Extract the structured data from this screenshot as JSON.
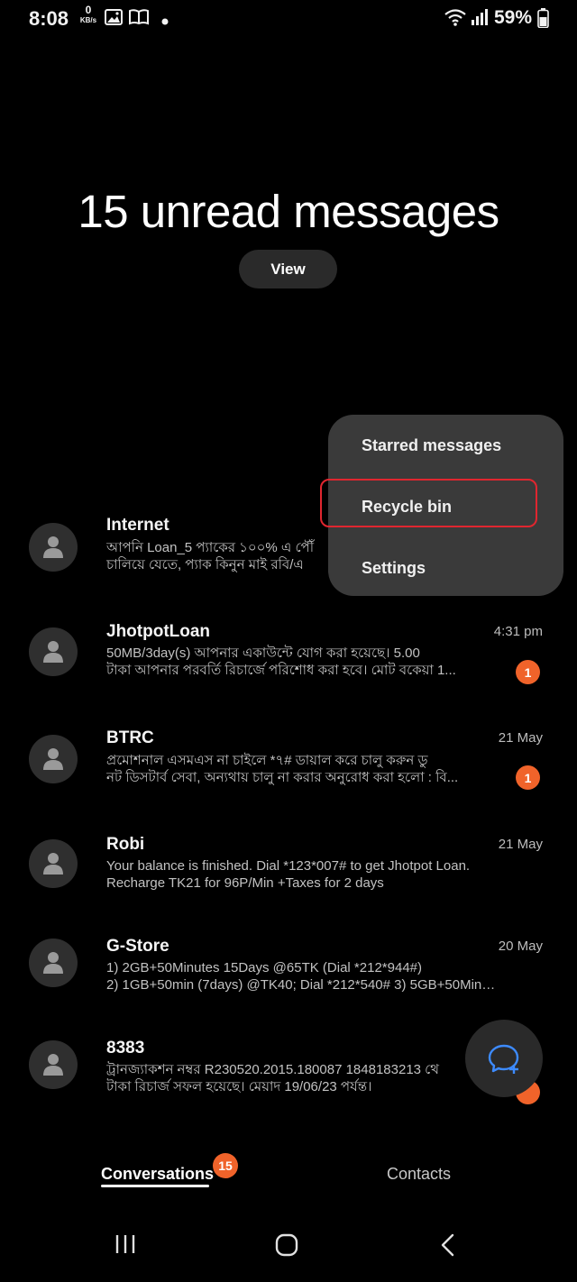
{
  "status_bar": {
    "time": "8:08",
    "net_speed_value": "0",
    "net_speed_unit": "KB/s",
    "battery": "59%"
  },
  "header": {
    "headline": "15 unread messages",
    "view_label": "View"
  },
  "menu": {
    "items": [
      {
        "label": "Starred messages"
      },
      {
        "label": "Recycle bin"
      },
      {
        "label": "Settings"
      }
    ]
  },
  "conversations": [
    {
      "name": "Internet",
      "time": "",
      "preview_line1": "আপনি Loan_5 প্যাকের ১০০% এ পৌঁ",
      "preview_line2": "চালিয়ে যেতে, প্যাক কিনুন মাই রবি/এ",
      "badge": ""
    },
    {
      "name": "JhotpotLoan",
      "time": "4:31 pm",
      "preview_line1": "50MB/3day(s) আপনার একাউন্টে যোগ করা হয়েছে। 5.00",
      "preview_line2": "টাকা আপনার পরবর্তি রিচার্জে পরিশোধ করা হবে। মোট বকেয়া 1...",
      "badge": "1"
    },
    {
      "name": "BTRC",
      "time": "21 May",
      "preview_line1": "প্রমোশনাল এসমএস না চাইলে *৭# ডায়াল করে চালু করুন ডু",
      "preview_line2": "নট ডিসটার্ব সেবা, অন্যথায় চালু না করার অনুরোধ করা হলো : বি...",
      "badge": "1"
    },
    {
      "name": "Robi",
      "time": "21 May",
      "preview_line1": "Your balance is finished. Dial *123*007# to get Jhotpot Loan.",
      "preview_line2": "Recharge TK21 for 96P/Min +Taxes for 2 days",
      "badge": ""
    },
    {
      "name": "G-Store",
      "time": "20 May",
      "preview_line1": "1) 2GB+50Minutes 15Days @65TK (Dial *212*944#)",
      "preview_line2": "2) 1GB+50min (7days) @TK40; Dial *212*540# 3) 5GB+50Mins(3...",
      "badge": ""
    },
    {
      "name": "8383",
      "time": "",
      "preview_line1": "ট্রানজ্যাকশন নম্বর R230520.2015.180087 1848183213 থে",
      "preview_line2": "টাকা রিচার্জ সফল হয়েছে। মেয়াদ 19/06/23 পর্যন্ত।",
      "badge": ""
    }
  ],
  "tabs": {
    "conversations": "Conversations",
    "conversations_badge": "15",
    "contacts": "Contacts"
  },
  "colors": {
    "background": "#000000",
    "accent_badge": "#f0632a",
    "menu_bg": "#3a3a3a",
    "highlight": "#e0262f",
    "fab_icon": "#3d8bff"
  }
}
